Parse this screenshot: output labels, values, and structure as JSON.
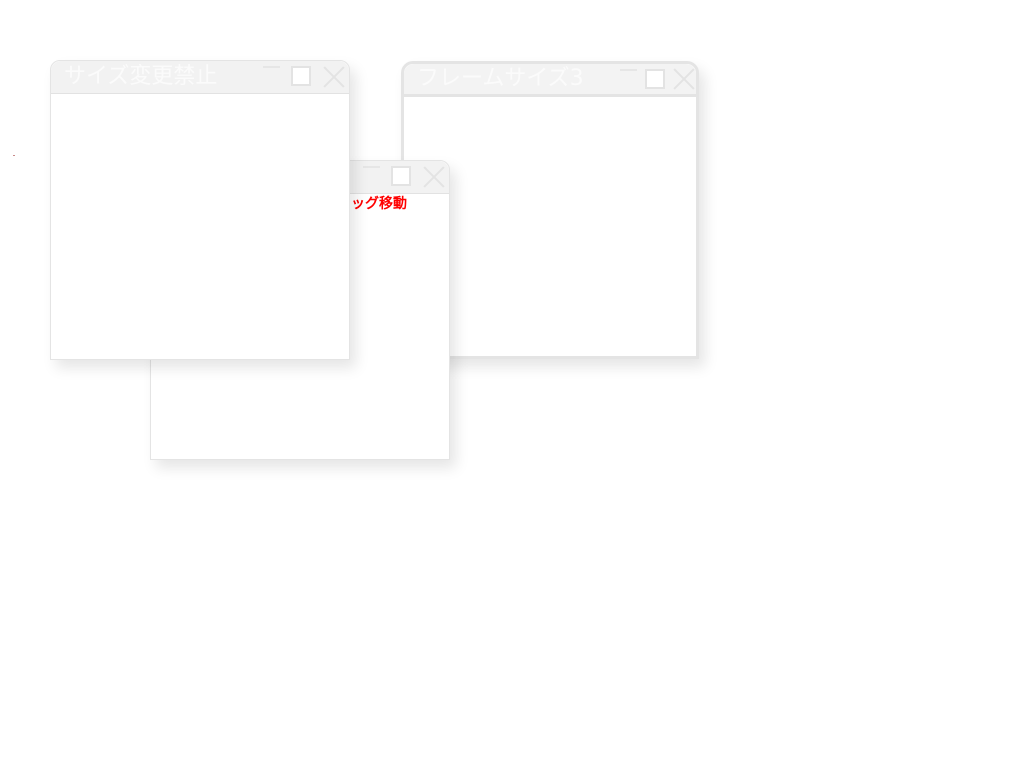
{
  "windows": {
    "frame3": {
      "title": "フレームサイズ3"
    },
    "moving": {
      "title": "",
      "body_text": "ドラッグ移動"
    },
    "no_resize": {
      "title": "サイズ変更禁止"
    }
  },
  "icons": {
    "minimize": "minimize-icon",
    "maximize": "maximize-icon",
    "close": "close-icon"
  },
  "colors": {
    "titlebar": "#f2f2f2",
    "frame": "#e4e4e4",
    "accent_text": "#ff0000"
  }
}
